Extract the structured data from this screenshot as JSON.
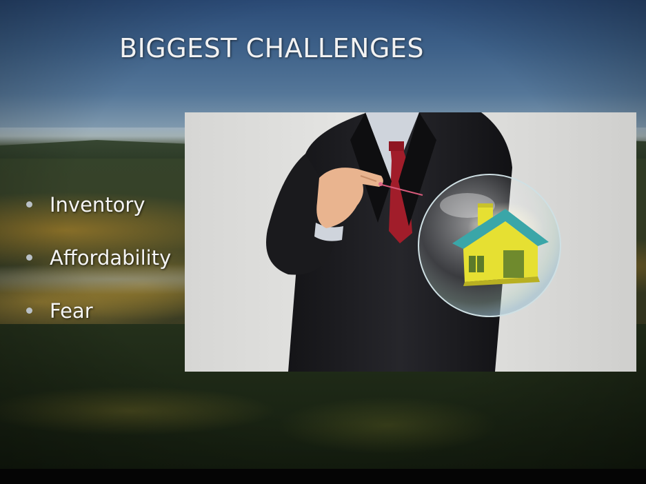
{
  "slide": {
    "title": "BIGGEST CHALLENGES",
    "bullets": [
      {
        "label": "Inventory"
      },
      {
        "label": "Affordability"
      },
      {
        "label": "Fear"
      }
    ]
  },
  "image": {
    "subject": "businessman-holding-pin-near-house-bubble-icon"
  },
  "colors": {
    "title_text": "#f2f2f2",
    "bullet_text": "#f4f4f4",
    "bullet_dot": "#b9c0c6",
    "suit": "#1c1c1f",
    "tie": "#a11d2a",
    "house_wall": "#e6e032",
    "house_roof": "#3aa6a8"
  }
}
